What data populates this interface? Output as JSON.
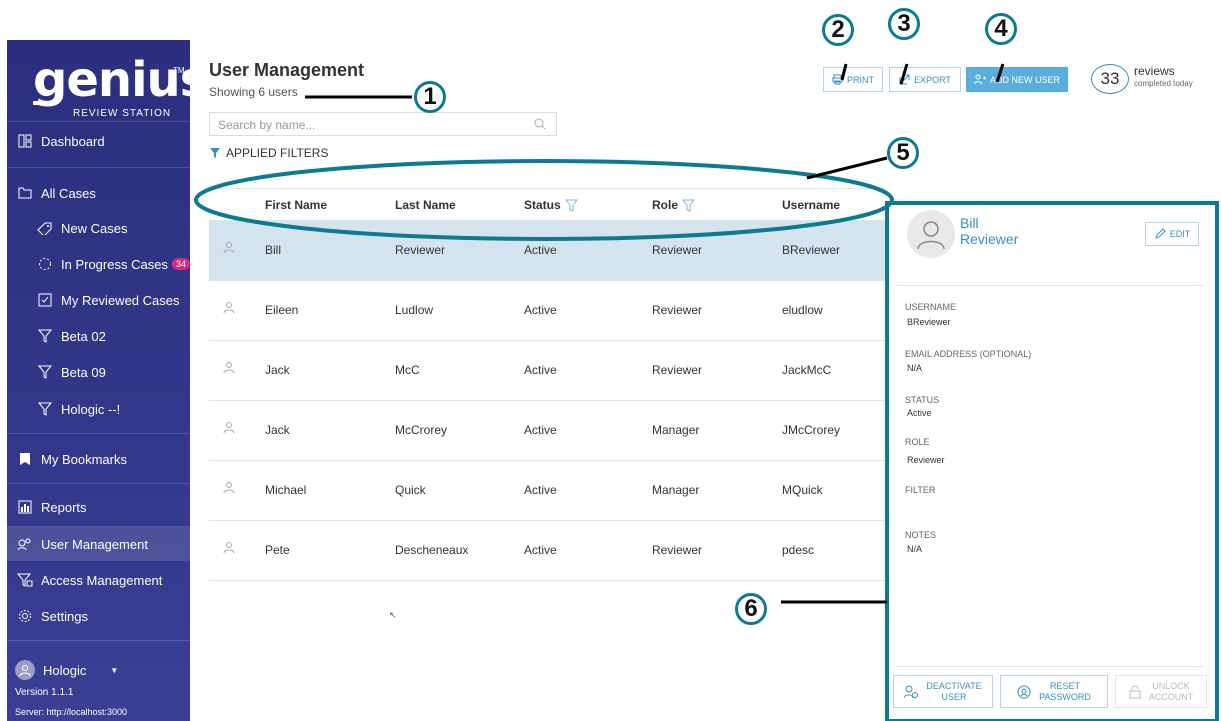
{
  "sidebar": {
    "logo_text": "genius",
    "logo_tm": "TM",
    "logo_sub": "REVIEW STATION",
    "items": [
      {
        "label": "Dashboard"
      },
      {
        "label": "All Cases"
      },
      {
        "label": "New Cases"
      },
      {
        "label": "In Progress Cases",
        "badge": "34"
      },
      {
        "label": "My Reviewed Cases"
      },
      {
        "label": "Beta 02"
      },
      {
        "label": "Beta 09"
      },
      {
        "label": "Hologic --!"
      },
      {
        "label": "My Bookmarks"
      },
      {
        "label": "Reports"
      },
      {
        "label": "User Management"
      },
      {
        "label": "Access Management"
      },
      {
        "label": "Settings"
      }
    ],
    "user": "Hologic",
    "version": "Version 1.1.1",
    "server": "Server: http://localhost:3000"
  },
  "header": {
    "title": "User Management",
    "subtitle": "Showing 6 users",
    "search_placeholder": "Search by name...",
    "applied_filters": "APPLIED FILTERS",
    "print": "PRINT",
    "export": "EXPORT",
    "add_user": "ADD NEW USER",
    "reviews_count": "33",
    "reviews_label": "reviews",
    "reviews_sub": "completed today"
  },
  "table": {
    "columns": [
      "First Name",
      "Last Name",
      "Status",
      "Role",
      "Username"
    ],
    "rows": [
      {
        "first": "Bill",
        "last": "Reviewer",
        "status": "Active",
        "role": "Reviewer",
        "username": "BReviewer"
      },
      {
        "first": "Eileen",
        "last": "Ludlow",
        "status": "Active",
        "role": "Reviewer",
        "username": "eludlow"
      },
      {
        "first": "Jack",
        "last": "McC",
        "status": "Active",
        "role": "Reviewer",
        "username": "JackMcC"
      },
      {
        "first": "Jack",
        "last": "McCrorey",
        "status": "Active",
        "role": "Manager",
        "username": "JMcCrorey"
      },
      {
        "first": "Michael",
        "last": "Quick",
        "status": "Active",
        "role": "Manager",
        "username": "MQuick"
      },
      {
        "first": "Pete",
        "last": "Descheneaux",
        "status": "Active",
        "role": "Reviewer",
        "username": "pdesc"
      }
    ]
  },
  "detail": {
    "first": "Bill",
    "last": "Reviewer",
    "edit": "EDIT",
    "username_label": "USERNAME",
    "username": "BReviewer",
    "email_label": "EMAIL ADDRESS (OPTIONAL)",
    "email": "N/A",
    "status_label": "STATUS",
    "status": "Active",
    "role_label": "ROLE",
    "role": "Reviewer",
    "filter_label": "FILTER",
    "notes_label": "NOTES",
    "notes": "N/A",
    "deactivate_1": "DEACTIVATE",
    "deactivate_2": "USER",
    "reset_1": "RESET",
    "reset_2": "PASSWORD",
    "unlock_1": "UNLOCK",
    "unlock_2": "ACCOUNT"
  },
  "annotations": [
    "1",
    "2",
    "3",
    "4",
    "5",
    "6"
  ],
  "colors": {
    "sidebar": "#2b2f7e",
    "accent": "#3a8fc2",
    "selected_row": "#d4e4ef",
    "callout": "#0e7a92",
    "badge": "#d9297a"
  }
}
